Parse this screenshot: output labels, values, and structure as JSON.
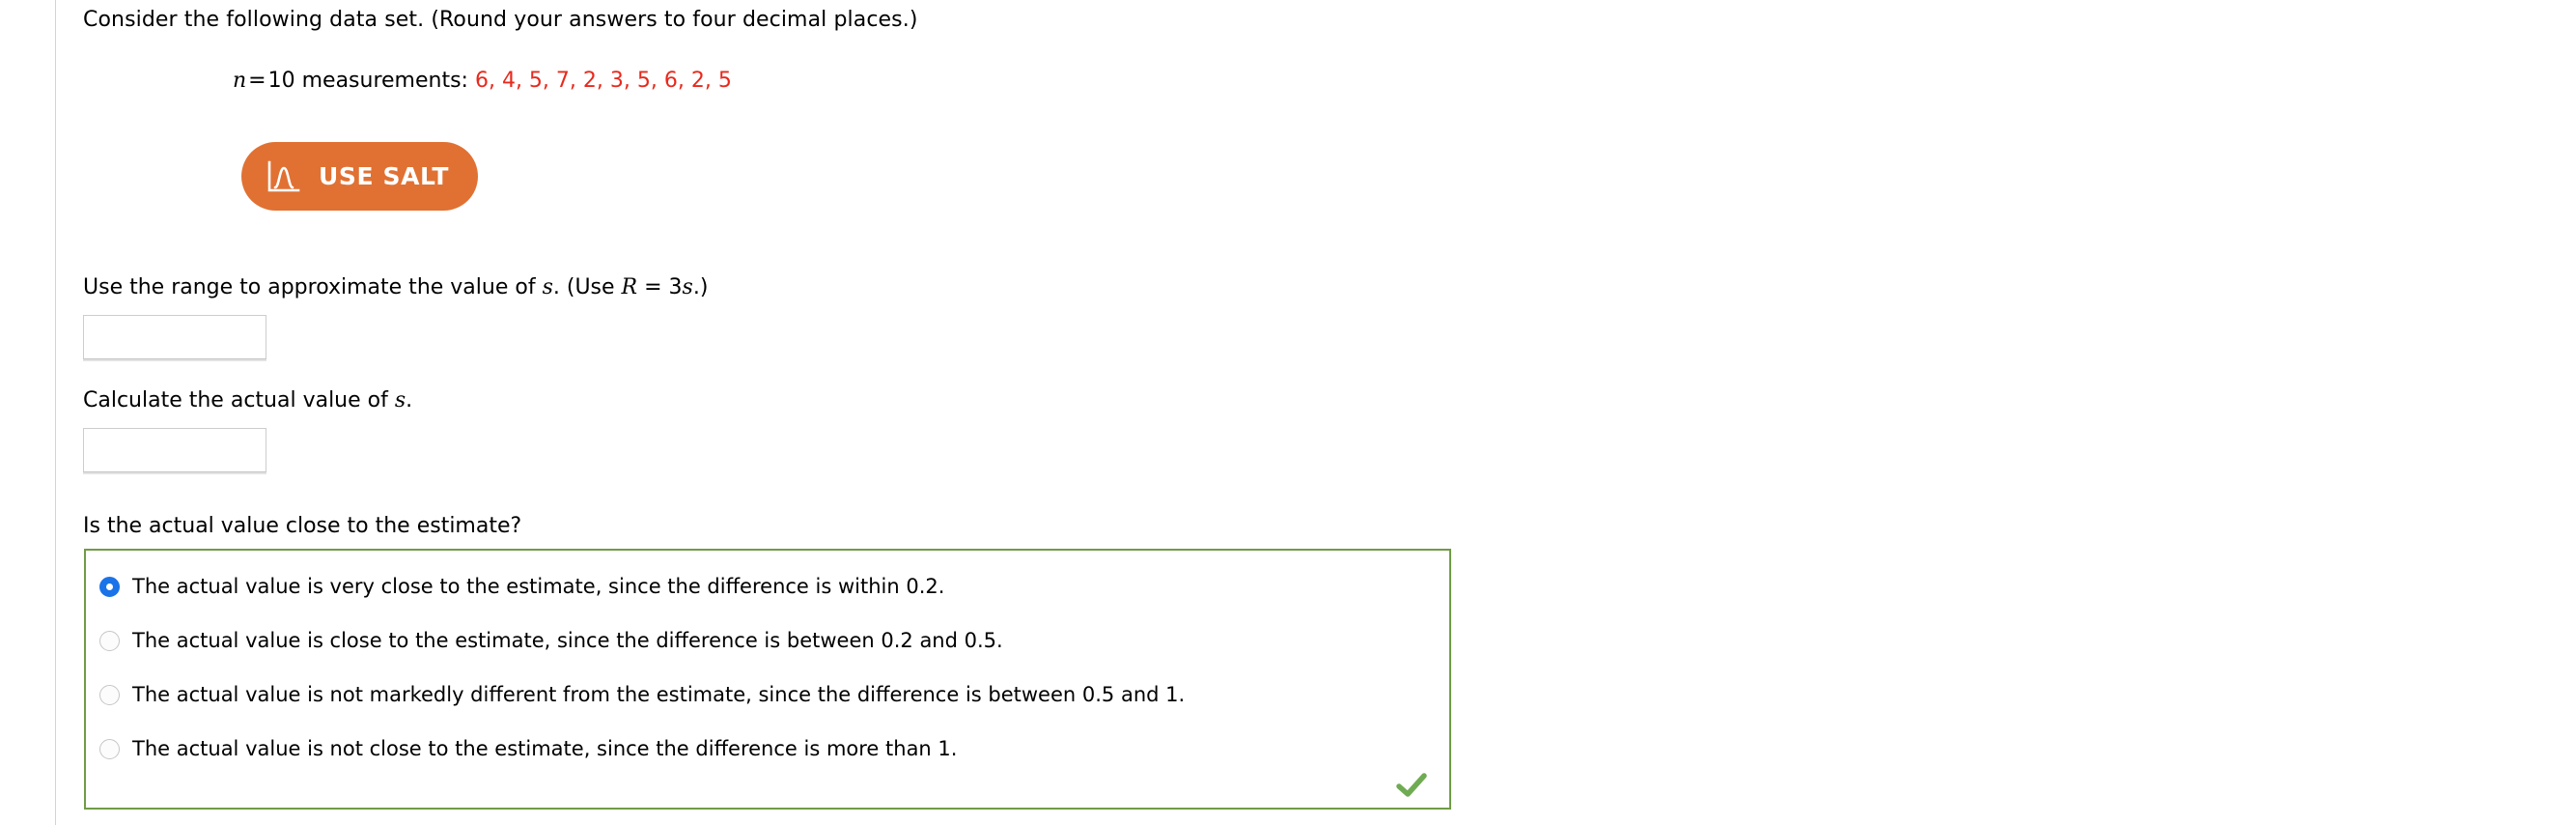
{
  "problem": {
    "intro": "Consider the following data set. (Round your answers to four decimal places.)",
    "sample_size_var": "n",
    "equals": "=",
    "measurements_label": "10 measurements:",
    "data_values": "6, 4, 5, 7, 2, 3, 5, 6, 2, 5",
    "data_color": "#e8291c"
  },
  "salt_button": {
    "label": "USE SALT",
    "icon": "distribution-curve-icon",
    "background": "#e07133",
    "text_color": "#ffffff"
  },
  "questions": [
    {
      "prefix": "Use the range to approximate the value of ",
      "var1": "s",
      "middle": ". (Use ",
      "var2": "R",
      "mid2": " = 3",
      "var3": "s",
      "suffix": ".)",
      "answer_value": "",
      "answer_placeholder": ""
    },
    {
      "prefix": "Calculate the actual value of ",
      "var1": "s",
      "suffix": ".",
      "answer_value": "",
      "answer_placeholder": ""
    }
  ],
  "multiple_choice": {
    "question": "Is the actual value close to the estimate?",
    "border_color": "#6f9c47",
    "status": "correct",
    "status_icon": "green-check-icon",
    "status_icon_color": "#6fab53",
    "selected_index": 0,
    "options": [
      {
        "label": "The actual value is very close to the estimate, since the difference is within 0.2.",
        "selected": true
      },
      {
        "label": "The actual value is close to the estimate, since the difference is between 0.2 and 0.5.",
        "selected": false
      },
      {
        "label": "The actual value is not markedly different from the estimate, since the difference is between 0.5 and 1.",
        "selected": false
      },
      {
        "label": "The actual value is not close to the estimate, since the difference is more than 1.",
        "selected": false
      }
    ]
  }
}
